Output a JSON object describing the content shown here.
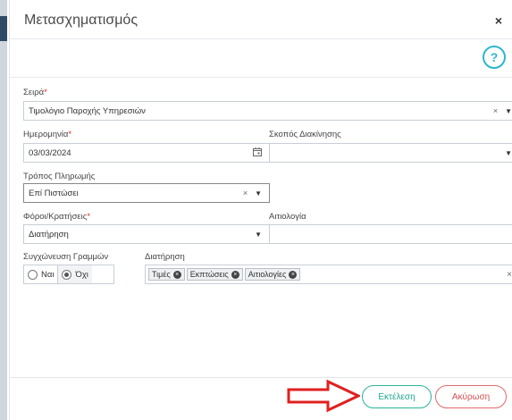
{
  "dialog": {
    "title": "Μετασχηματισμός",
    "close_symbol": "×",
    "help_symbol": "?"
  },
  "form": {
    "series": {
      "label": "Σειρά",
      "required_mark": "*",
      "value": "Τιμολόγιο Παροχής Υπηρεσιών"
    },
    "date": {
      "label": "Ημερομηνία",
      "required_mark": "*",
      "value": "03/03/2024"
    },
    "transport_purpose": {
      "label": "Σκοπός Διακίνησης",
      "value": ""
    },
    "payment_method": {
      "label": "Τρόπος Πληρωμής",
      "value": "Επί Πιστώσει"
    },
    "taxes": {
      "label": "Φόροι/Κρατήσεις",
      "required_mark": "*",
      "value": "Διατήρηση"
    },
    "justification": {
      "label": "Αιτιολογία",
      "value": ""
    },
    "merge_lines": {
      "label": "Συγχώνευση Γραμμών",
      "options": [
        {
          "label": "Ναι",
          "selected": false
        },
        {
          "label": "Όχι",
          "selected": true
        }
      ]
    },
    "retain": {
      "label": "Διατήρηση",
      "tags": [
        "Τιμές",
        "Εκπτώσεις",
        "Αιτιολογίες"
      ]
    }
  },
  "icons": {
    "clear": "×",
    "caret": "▼",
    "calendar": "calendar-icon"
  },
  "footer": {
    "execute_label": "Εκτέλεση",
    "cancel_label": "Ακύρωση"
  },
  "colors": {
    "accent_teal": "#2bb7cc",
    "execute_green": "#2ab59a",
    "cancel_red": "#e06a6a",
    "arrow_red": "#e02020",
    "required_red": "#d9302f"
  }
}
